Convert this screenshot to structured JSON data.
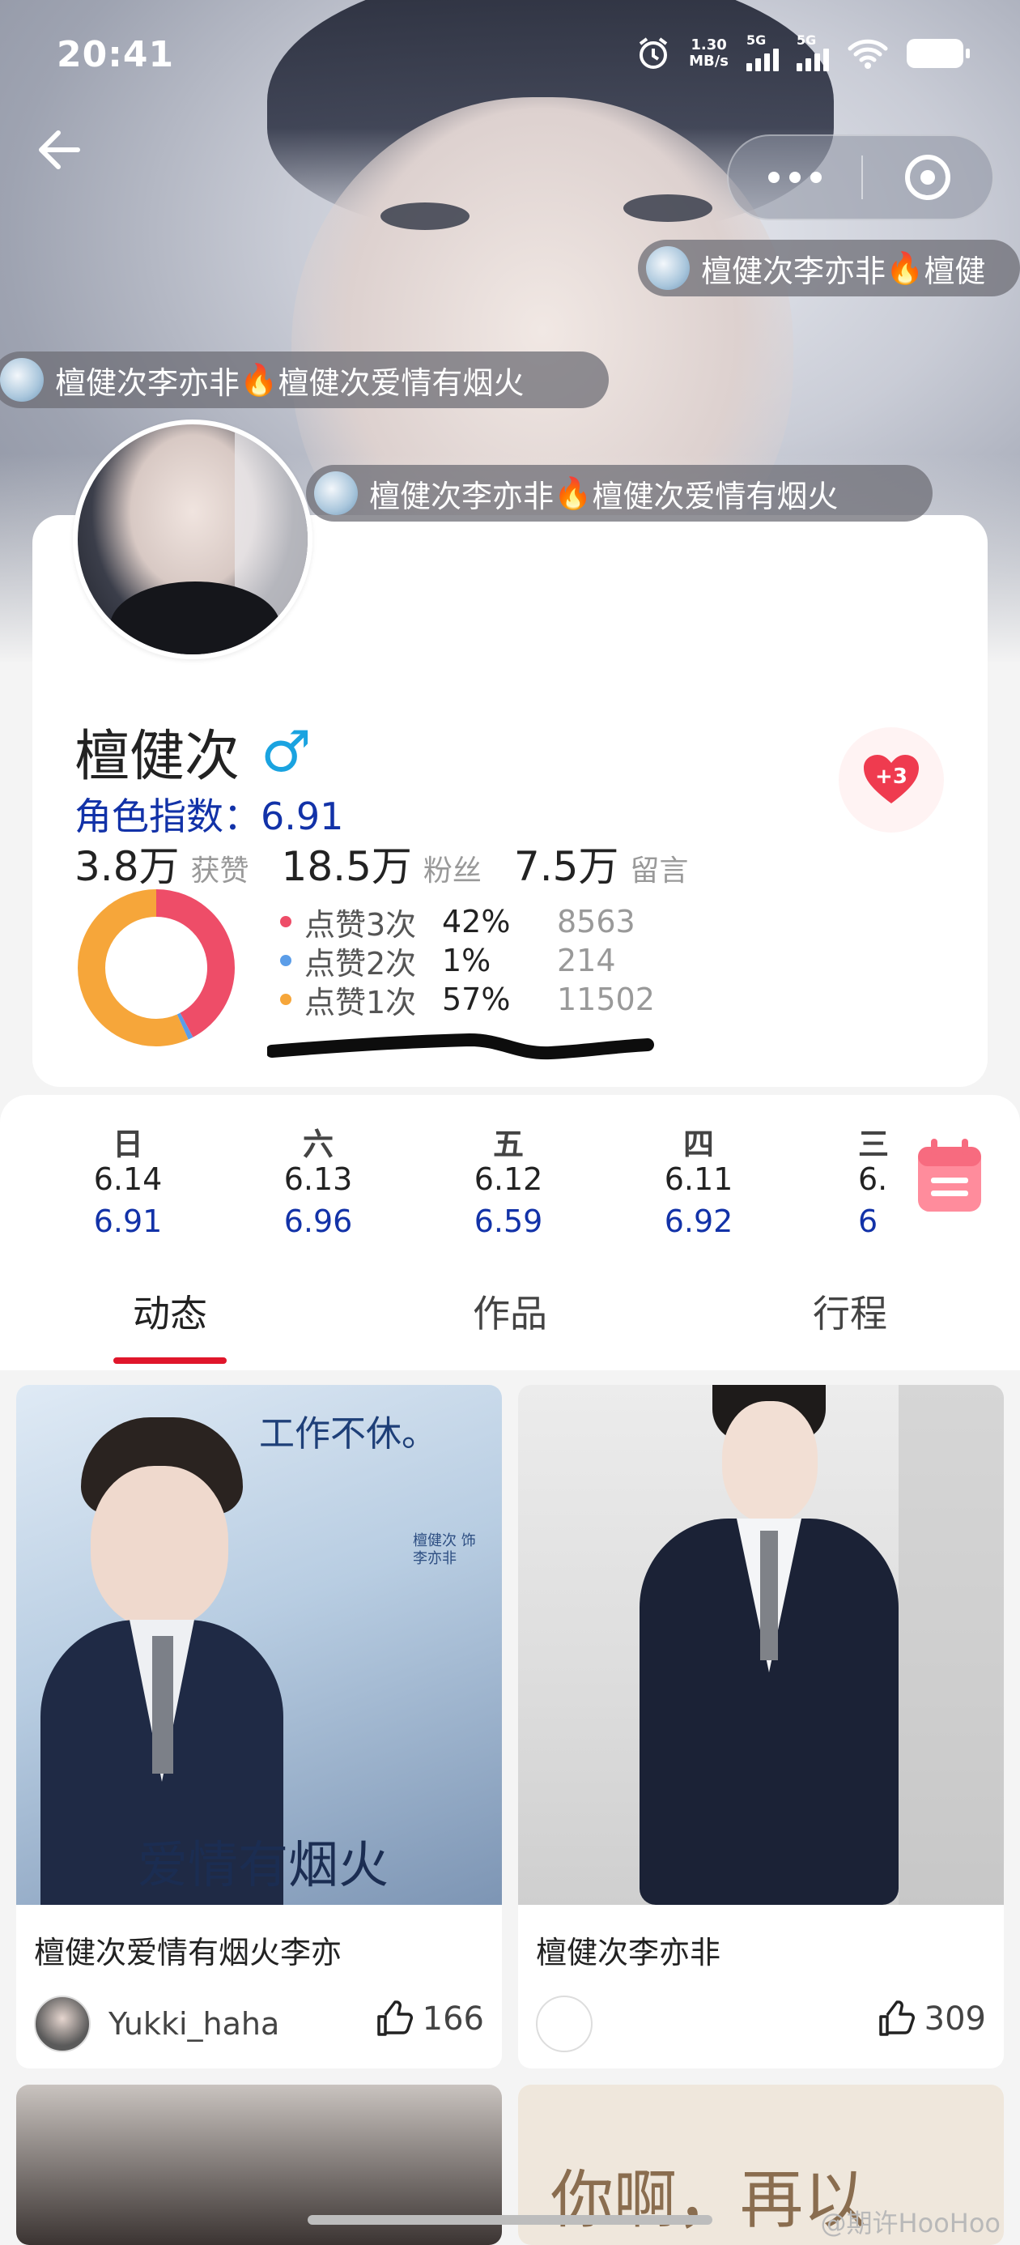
{
  "status_bar": {
    "time": "20:41",
    "net_speed": "1.30",
    "net_unit": "MB/s",
    "sig1": "5G",
    "sig2": "5G"
  },
  "danmaku": [
    {
      "text_a": "檀健次李亦非",
      "text_b": "檀健"
    },
    {
      "text_a": "檀健次李亦非",
      "text_b": "檀健次爱情有烟火"
    },
    {
      "text_a": "檀健次李亦非",
      "text_b": "檀健次爱情有烟火"
    }
  ],
  "profile": {
    "name": "檀健次",
    "gender_symbol": "♂",
    "index_label": "角色指数：6.91",
    "stats": [
      {
        "value": "3.8万",
        "label": "获赞"
      },
      {
        "value": "18.5万",
        "label": "粉丝"
      },
      {
        "value": "7.5万",
        "label": "留言"
      }
    ],
    "heart_badge": "+3"
  },
  "chart_data": {
    "type": "pie",
    "categories": [
      "点赞3次",
      "点赞2次",
      "点赞1次"
    ],
    "values": [
      8563,
      214,
      11502
    ],
    "percent_labels": [
      "42%",
      "1%",
      "57%"
    ],
    "count_labels": [
      "8563",
      "214",
      "11502"
    ],
    "colors": [
      "#ee4d68",
      "#5b9de8",
      "#f6a63a"
    ]
  },
  "days": [
    {
      "dow": "日",
      "date": "6.14",
      "score": "6.91"
    },
    {
      "dow": "六",
      "date": "6.13",
      "score": "6.96"
    },
    {
      "dow": "五",
      "date": "6.12",
      "score": "6.59"
    },
    {
      "dow": "四",
      "date": "6.11",
      "score": "6.92"
    },
    {
      "dow": "三",
      "date": "6.",
      "score": "6"
    }
  ],
  "tabs": [
    "动态",
    "作品",
    "行程"
  ],
  "posts": [
    {
      "title": "檀健次爱情有烟火李亦",
      "author": "Yukki_haha",
      "likes": "166",
      "poster_top": "工作不休。",
      "poster_small": "檀健次 饰 李亦非",
      "poster_logo": "爱情有烟火"
    },
    {
      "title": "檀健次李亦非",
      "author": "",
      "likes": "309"
    }
  ],
  "teaser_text": "你啊，再以",
  "watermark": "@期许HooHoo",
  "colors": {
    "accent_blue": "#1232a8",
    "accent_red": "#e0162b",
    "male_blue": "#1aa3e0"
  }
}
